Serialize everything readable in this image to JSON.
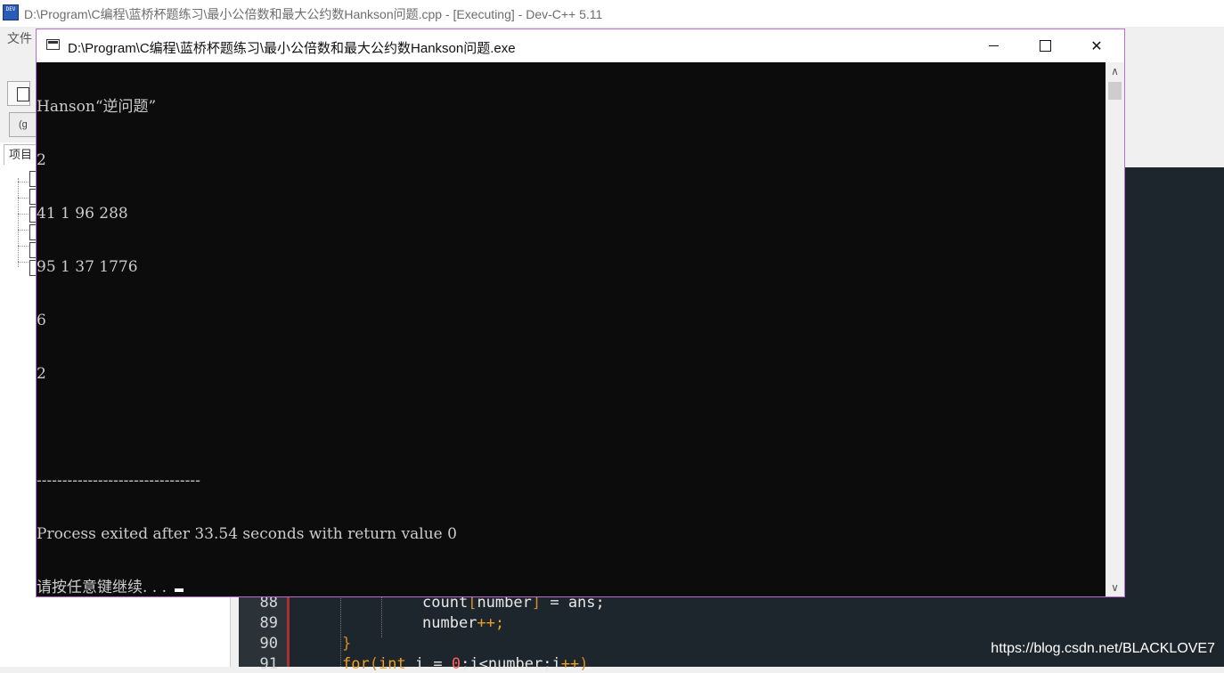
{
  "ide": {
    "icon_text": "DEV",
    "title": "D:\\Program\\C编程\\蓝桥杯题练习\\最小公倍数和最大公约数Hankson问题.cpp - [Executing] - Dev-C++ 5.11",
    "menu_file": "文件",
    "toolbar_combo": "(g",
    "project_tab": "项目"
  },
  "editor": {
    "lines": [
      {
        "no": "88",
        "parts": [
          {
            "t": "count",
            "c": ""
          },
          {
            "t": "[",
            "c": "br"
          },
          {
            "t": "number",
            "c": ""
          },
          {
            "t": "]",
            "c": "br"
          },
          {
            "t": " = ans;",
            "c": ""
          }
        ]
      },
      {
        "no": "89",
        "parts": [
          {
            "t": "number",
            "c": ""
          },
          {
            "t": "++;",
            "c": "kw"
          }
        ]
      },
      {
        "no": "90",
        "parts": [
          {
            "t": "}",
            "c": "br"
          }
        ]
      },
      {
        "no": "91",
        "parts": [
          {
            "t": "for",
            "c": "kw"
          },
          {
            "t": "(",
            "c": "br"
          },
          {
            "t": "int",
            "c": "kw"
          },
          {
            "t": " i = ",
            "c": ""
          },
          {
            "t": "0",
            "c": "num"
          },
          {
            "t": ";i<number;i",
            "c": ""
          },
          {
            "t": "++",
            "c": "kw"
          },
          {
            "t": ")",
            "c": "br"
          }
        ]
      }
    ]
  },
  "console": {
    "title": "D:\\Program\\C编程\\蓝桥杯题练习\\最小公倍数和最大公约数Hankson问题.exe",
    "output": [
      "Hanson“逆问题”",
      "2",
      "41 1 96 288",
      "95 1 37 1776",
      "6",
      "2",
      "",
      "--------------------------------",
      "Process exited after 33.54 seconds with return value 0",
      "请按任意键继续. . . "
    ],
    "buttons": {
      "minimize": "minimize",
      "maximize": "maximize",
      "close": "✕"
    },
    "scroll_up": "∧",
    "scroll_down": "∨"
  },
  "watermark": "https://blog.csdn.net/BLACKLOVE7",
  "colors": {
    "console_bg": "#0c0c0c",
    "console_text": "#cccccc",
    "window_border": "#b86bd0",
    "editor_bg": "#1e262d",
    "keyword": "#f0a020"
  }
}
